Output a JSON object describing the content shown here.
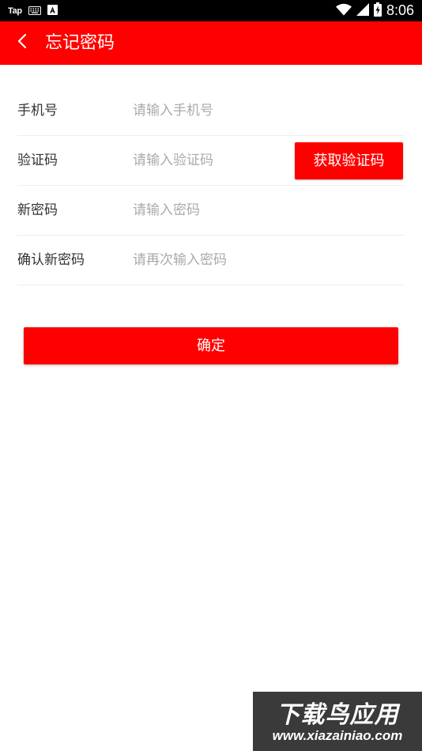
{
  "status_bar": {
    "left_app_label": "Tap",
    "time": "8:06",
    "icons": [
      "keyboard-icon",
      "a-box-icon",
      "wifi-icon",
      "signal-icon",
      "battery-charging-icon"
    ]
  },
  "app_bar": {
    "title": "忘记密码",
    "back_icon": "chevron-left-icon"
  },
  "form": {
    "phone": {
      "label": "手机号",
      "placeholder": "请输入手机号",
      "value": ""
    },
    "code": {
      "label": "验证码",
      "placeholder": "请输入验证码",
      "value": "",
      "button_label": "获取验证码"
    },
    "new_password": {
      "label": "新密码",
      "placeholder": "请输入密码",
      "value": ""
    },
    "confirm_password": {
      "label": "确认新密码",
      "placeholder": "请再次输入密码",
      "value": ""
    }
  },
  "confirm_label": "确定",
  "watermark": {
    "title": "下载鸟应用",
    "url": "www.xiazainiao.com"
  },
  "colors": {
    "primary": "#ff0000",
    "status_bar": "#000000",
    "label_text": "#333333",
    "placeholder_text": "#aaaaaa",
    "divider": "#eeeeee"
  }
}
